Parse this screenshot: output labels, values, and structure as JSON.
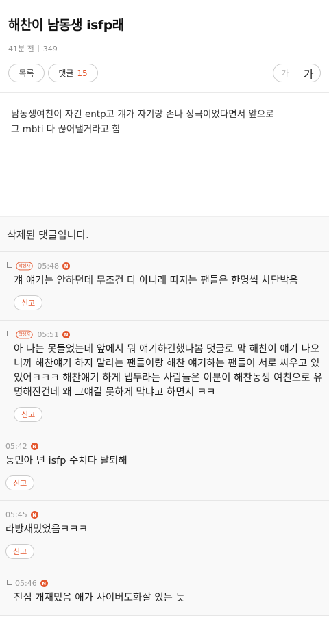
{
  "post": {
    "title": "해찬이 남동생 isfp래",
    "time": "41분 전",
    "views": "349",
    "list_label": "목록",
    "comment_label": "댓글",
    "comment_count": "15",
    "font_small": "가",
    "font_big": "가",
    "body_line1": "남동생여친이 자긴 entp고 걔가 자기랑 존나 상극이었다면서 앞으로",
    "body_line2": "그 mbti 다 끊어낼거라고 함"
  },
  "deleted_comment": "삭제된 댓글입니다.",
  "comments": [
    {
      "writer_badge": "작성자",
      "time": "05:48",
      "new": "N",
      "text": "걔 얘기는 안하던데 무조건 다 아니래 따지는 팬들은 한명씩 차단박음",
      "report": "신고"
    },
    {
      "writer_badge": "작성자",
      "time": "05:51",
      "new": "N",
      "text": "아 나는 못들었는데 앞에서 뭐 얘기하긴했나봄 댓글로 막 해찬이 얘기 나오니까 해찬얘기 하지 말라는 팬들이랑 해찬 얘기하는 팬들이 서로 싸우고 있었어ㅋㅋㅋ 해찬얘기 하게 냅두라는 사람들은 이분이 해찬동생 여친으로 유명해진건데 왜 그얘길 못하게 막냐고 하면서 ㅋㅋ",
      "report": "신고"
    },
    {
      "time": "05:42",
      "new": "N",
      "text": "동민아 넌 isfp 수치다 탈퇴해",
      "report": "신고"
    },
    {
      "time": "05:45",
      "new": "N",
      "text": "라방재밌었음ㅋㅋㅋ",
      "report": "신고"
    },
    {
      "time": "05:46",
      "new": "N",
      "text": "진심 개재밌음 애가 사이버도화살 있는 듯"
    }
  ]
}
